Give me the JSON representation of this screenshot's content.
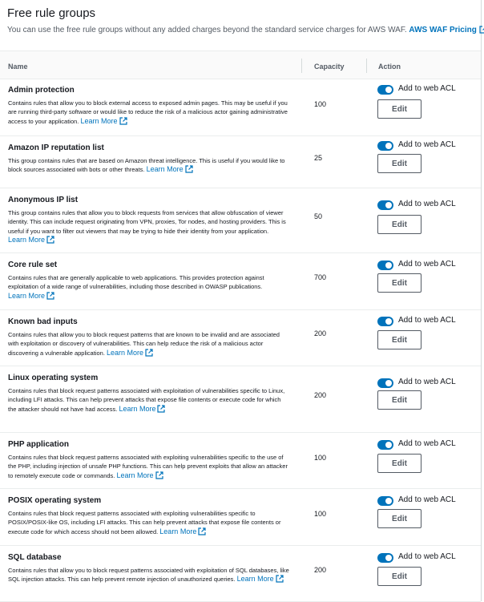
{
  "header": {
    "title": "Free rule groups",
    "description": "You can use the free rule groups without any added charges beyond the standard service charges for AWS WAF.",
    "pricing_link": "AWS WAF Pricing"
  },
  "table": {
    "columns": {
      "name": "Name",
      "capacity": "Capacity",
      "action": "Action"
    },
    "learn_more": "Learn More",
    "toggle_label": "Add to web ACL",
    "edit_label": "Edit",
    "rows": [
      {
        "name": "Admin protection",
        "description": "Contains rules that allow you to block external access to exposed admin pages. This may be useful if you are running third-party software or would like to reduce the risk of a malicious actor gaining administrative access to your application.",
        "capacity": "100",
        "enabled": true
      },
      {
        "name": "Amazon IP reputation list",
        "description": "This group contains rules that are based on Amazon threat intelligence. This is useful if you would like to block sources associated with bots or other threats.",
        "capacity": "25",
        "enabled": true
      },
      {
        "name": "Anonymous IP list",
        "description": "This group contains rules that allow you to block requests from services that allow obfuscation of viewer identity. This can include request originating from VPN, proxies, Tor nodes, and hosting providers. This is useful if you want to filter out viewers that may be trying to hide their identity from your application.",
        "capacity": "50",
        "enabled": true
      },
      {
        "name": "Core rule set",
        "description": "Contains rules that are generally applicable to web applications. This provides protection against exploitation of a wide range of vulnerabilities, including those described in OWASP publications.",
        "capacity": "700",
        "enabled": true
      },
      {
        "name": "Known bad inputs",
        "description": "Contains rules that allow you to block request patterns that are known to be invalid and are associated with exploitation or discovery of vulnerabilities. This can help reduce the risk of a malicious actor discovering a vulnerable application.",
        "capacity": "200",
        "enabled": true
      },
      {
        "name": "Linux operating system",
        "description": "Contains rules that block request patterns associated with exploitation of vulnerabilities specific to Linux, including LFI attacks. This can help prevent attacks that expose file contents or execute code for which the attacker should not have had access.",
        "capacity": "200",
        "enabled": true
      },
      {
        "name": "PHP application",
        "description": "Contains rules that block request patterns associated with exploiting vulnerabilities specific to the use of the PHP, including injection of unsafe PHP functions. This can help prevent exploits that allow an attacker to remotely execute code or commands.",
        "capacity": "100",
        "enabled": true
      },
      {
        "name": "POSIX operating system",
        "description": "Contains rules that block request patterns associated with exploiting vulnerabilities specific to POSIX/POSIX-like OS, including LFI attacks. This can help prevent attacks that expose file contents or execute code for which access should not been allowed.",
        "capacity": "100",
        "enabled": true
      },
      {
        "name": "SQL database",
        "description": "Contains rules that allow you to block request patterns associated with exploitation of SQL databases, like SQL injection attacks. This can help prevent remote injection of unauthorized queries.",
        "capacity": "200",
        "enabled": true
      }
    ]
  }
}
